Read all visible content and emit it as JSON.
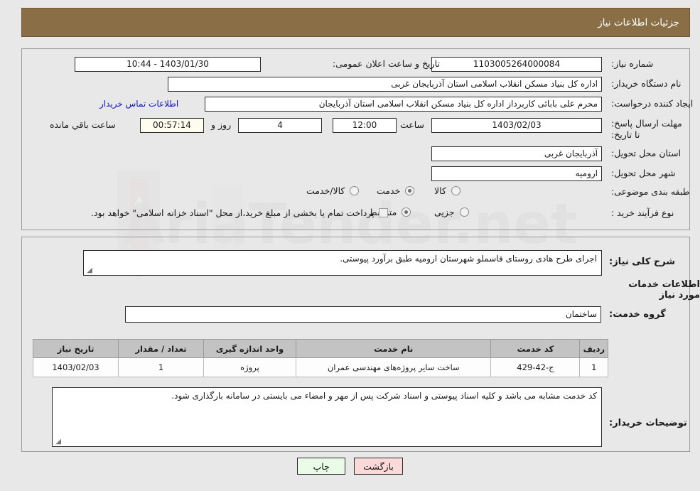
{
  "header": {
    "title": "جزئیات اطلاعات نیاز"
  },
  "info": {
    "need_number_label": "شماره نیاز:",
    "need_number_value": "1103005264000084",
    "announce_label": "تاریخ و ساعت اعلان عمومی:",
    "announce_value": "1403/01/30 - 10:44",
    "buyer_org_label": "نام دستگاه خریدار:",
    "buyer_org_value": "اداره کل بنیاد مسکن انقلاب اسلامی استان آذربایجان غربی",
    "requester_label": "ایجاد کننده درخواست:",
    "requester_value": "محرم علی بابائی کاربرداز اداره کل بنیاد مسکن انقلاب اسلامی استان آذربایجان",
    "contact_link": "اطلاعات تماس خریدار",
    "deadline_label": "مهلت ارسال پاسخ: تا تاریخ:",
    "deadline_date": "1403/02/03",
    "hour_label": "ساعت",
    "hour_value": "12:00",
    "days_value": "4",
    "days_label": "روز و",
    "countdown_value": "00:57:14",
    "countdown_label": "ساعت باقي مانده",
    "province_label": "استان محل تحویل:",
    "province_value": "آذربایجان غربی",
    "city_label": "شهر محل تحویل:",
    "city_value": "ارومیه",
    "category_label": "طبقه بندی موضوعی:",
    "category_options": [
      "کالا",
      "خدمت",
      "کالا/خدمت"
    ],
    "category_selected": "خدمت",
    "process_label": "نوع فرآیند خرید :",
    "process_options": [
      "جزیی",
      "متوسط"
    ],
    "process_selected": "متوسط",
    "treasury_note": "پرداخت تمام یا بخشی از مبلغ خرید،از محل \"اسناد خزانه اسلامی\" خواهد بود.",
    "treasury_checked": false
  },
  "summary": {
    "label": "شرح کلی نیاز:",
    "value": "اجرای طرح هادی روستای قاسملو شهرستان ارومیه طبق برآورد پیوستی."
  },
  "services_section": {
    "heading": "اطلاعات خدمات مورد نیاز",
    "group_label": "گروه خدمت:",
    "group_value": "ساختمان"
  },
  "table": {
    "columns": [
      "ردیف",
      "کد خدمت",
      "نام خدمت",
      "واحد اندازه گیری",
      "تعداد / مقدار",
      "تاریخ نیاز"
    ],
    "rows": [
      {
        "index": "1",
        "code": "ج-42-429",
        "name": "ساخت سایر پروژه‌های مهندسی عمران",
        "unit": "پروژه",
        "quantity": "1",
        "need_date": "1403/02/03"
      }
    ]
  },
  "buyer_notes": {
    "label": "توضیحات خریدار:",
    "value": "کد خدمت مشابه می باشد و کلیه اسناد پیوستی و اسناد شرکت پس از مهر و امضاء می بایستی در سامانه بارگذاری شود."
  },
  "footer": {
    "print_label": "چاپ",
    "back_label": "بازگشت"
  },
  "watermark": {
    "text": "AriaTender.net"
  },
  "colors": {
    "header_bg": "#8a6f46",
    "link": "#1414c8",
    "print_btn": "#eafbe7",
    "back_btn": "#fbd9d9",
    "table_header": "#c3c3c3",
    "countdown_bg": "#fffdf0"
  }
}
